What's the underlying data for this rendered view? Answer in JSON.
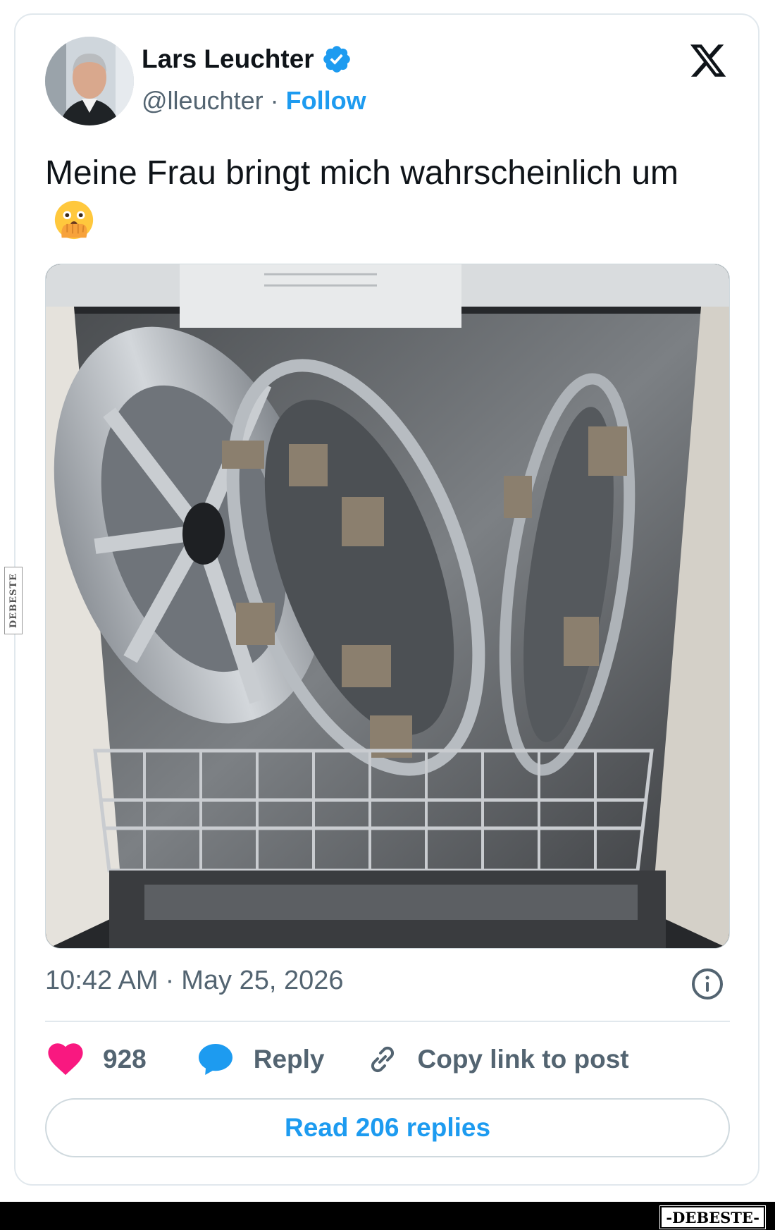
{
  "author": {
    "name": "Lars Leuchter",
    "handle": "@lleuchter",
    "separator": "·",
    "follow_label": "Follow",
    "verified_icon": "verified-badge-icon",
    "brand_color": "#1d9bf0"
  },
  "platform_logo": "x-logo-icon",
  "tweet": {
    "text": "Meine Frau bringt mich wahrscheinlich um",
    "emoji": "face-with-open-eyes-and-hand-over-mouth-icon"
  },
  "media": {
    "kind": "photo",
    "icon": "dishwasher-with-hubcaps-photo"
  },
  "meta": {
    "time": "10:42 AM",
    "separator": "·",
    "date": "May 25, 2026"
  },
  "actions": {
    "likes_count": "928",
    "reply_label": "Reply",
    "copy_link_label": "Copy link to post"
  },
  "read_replies_label": "Read 206 replies",
  "watermark": {
    "side_text": "DEBESTE",
    "bottom_text": "-DEBESTE-"
  },
  "colors": {
    "like": "#f91880",
    "reply": "#1d9bf0",
    "text_secondary": "#536471"
  }
}
